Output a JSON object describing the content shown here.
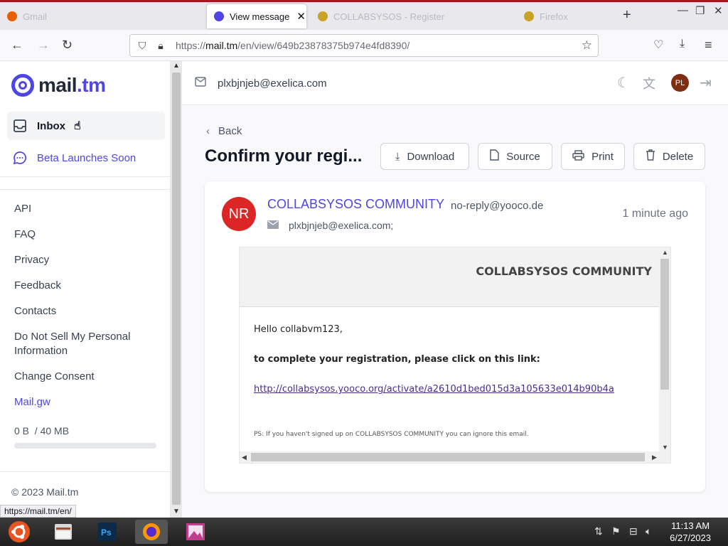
{
  "browser": {
    "tabs": [
      {
        "label": "Gmail",
        "active": false
      },
      {
        "label": "View message",
        "active": true
      },
      {
        "label": "COLLABSYSOS - Register",
        "active": false
      },
      {
        "label": "Firefox",
        "active": false
      }
    ],
    "url_prefix": "https://",
    "url_host": "mail.tm",
    "url_path": "/en/view/649b23878375b974e4fd8390/"
  },
  "sidebar": {
    "logo_a": "mail",
    "logo_b": ".tm",
    "inbox": "Inbox",
    "beta": "Beta Launches Soon",
    "links": [
      "API",
      "FAQ",
      "Privacy",
      "Feedback",
      "Contacts",
      "Do Not Sell My Personal Information",
      "Change Consent"
    ],
    "mailgw": "Mail.gw",
    "storage": "0 B  / 40 MB",
    "storage_fraction": 0,
    "copyright": "© 2023 Mail.tm",
    "status_url": "https://mail.tm/en/"
  },
  "topbar": {
    "account": "plxbjnjeb@exelica.com",
    "avatar": "PL"
  },
  "message": {
    "back": "Back",
    "title": "Confirm your regi...",
    "actions": {
      "download": "Download",
      "source": "Source",
      "print": "Print",
      "delete": "Delete"
    },
    "avatar": "NR",
    "from_name": "COLLABSYSOS COMMUNITY",
    "from_addr": "no-reply@yooco.de",
    "to": "plxbjnjeb@exelica.com;",
    "time": "1 minute ago",
    "body": {
      "brand": "COLLABSYSOS COMMUNITY",
      "hello": "Hello collabvm123,",
      "instruction": "to complete your registration, please click on this link:",
      "link": "http://collabsysos.yooco.org/activate/a2610d1bed015d3a105633e014b90b4a",
      "ps": "PS: If you haven't signed up on COLLABSYSOS COMMUNITY you can ignore this email."
    }
  },
  "taskbar": {
    "time": "11:13 AM",
    "date": "6/27/2023"
  },
  "colors": {
    "accent": "#4f46e5",
    "avatar_red": "#dc2626",
    "chrome_red": "#a11a1f"
  }
}
